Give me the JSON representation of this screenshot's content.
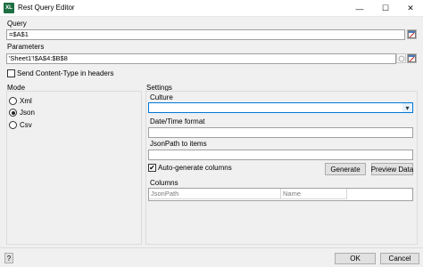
{
  "window": {
    "app_icon": "XL",
    "title": "Rest Query Editor",
    "minimize_icon": "—",
    "maximize_icon": "☐",
    "close_icon": "✕"
  },
  "query": {
    "label": "Query",
    "value": "=$A$1"
  },
  "parameters": {
    "label": "Parameters",
    "value": "'Sheet1'!$A$4:$B$8"
  },
  "send_content_type": {
    "label": "Send Content-Type in headers",
    "checked": false
  },
  "mode": {
    "label": "Mode",
    "options": [
      {
        "label": "Xml",
        "selected": false
      },
      {
        "label": "Json",
        "selected": true
      },
      {
        "label": "Csv",
        "selected": false
      }
    ]
  },
  "settings": {
    "label": "Settings",
    "culture_label": "Culture",
    "culture_value": "",
    "datetime_label": "Date/Time format",
    "datetime_value": "",
    "jsonpath_label": "JsonPath to items",
    "jsonpath_value": "",
    "auto_generate_label": "Auto-generate columns",
    "auto_generate_checked": true,
    "check_mark": "✔",
    "generate_label": "Generate",
    "preview_label": "Preview Data",
    "columns_label": "Columns",
    "columns_headers": [
      "JsonPath",
      "Name"
    ],
    "dropdown_arrow": "▾"
  },
  "footer": {
    "help_label": "?",
    "ok_label": "OK",
    "cancel_label": "Cancel"
  },
  "colors": {
    "combo_border": "#0078d7",
    "dropdown_bg": "#e5f1fb"
  }
}
